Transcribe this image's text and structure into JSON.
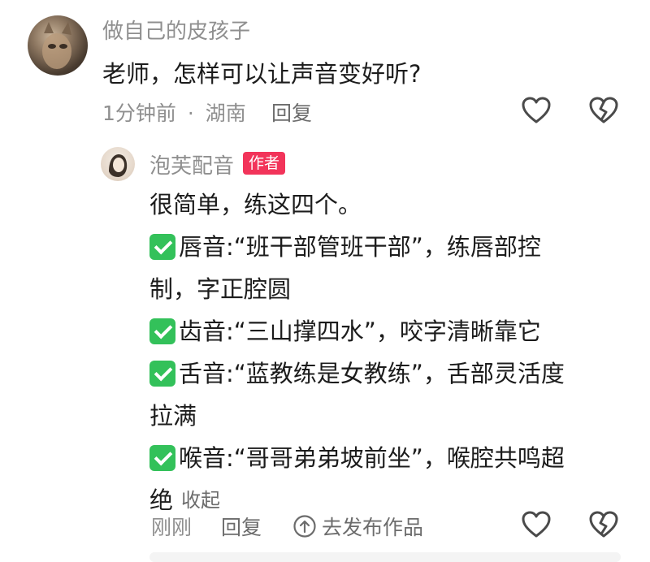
{
  "comment": {
    "username": "做自己的皮孩子",
    "text": "老师，怎样可以让声音变好听?",
    "time": "1分钟前",
    "separator": "·",
    "location": "湖南",
    "reply_label": "回复"
  },
  "reply": {
    "username": "泡芙配音",
    "badge": "作者",
    "lines": [
      "很简单，练这四个。",
      "唇音:“班干部管班干部”，练唇部控",
      "制，字正腔圆",
      "齿音:“三山撑四水”，咬字清晰靠它",
      "舌音:“蓝教练是女教练”，舌部灵活度",
      "拉满",
      "喉音:“哥哥弟弟坡前坐”，喉腔共鸣超",
      "绝"
    ],
    "collapse_label": "收起",
    "time": "刚刚",
    "reply_label": "回复",
    "post_works_label": "去发布作品"
  },
  "icons": {
    "like": "heart-outline-icon",
    "dislike": "broken-heart-icon",
    "upload": "arrow-up-circle-icon",
    "check": "green-check-box-emoji"
  },
  "colors": {
    "badge": "#f2345a",
    "check": "#33c15a",
    "muted_text": "#8f8f8f"
  }
}
